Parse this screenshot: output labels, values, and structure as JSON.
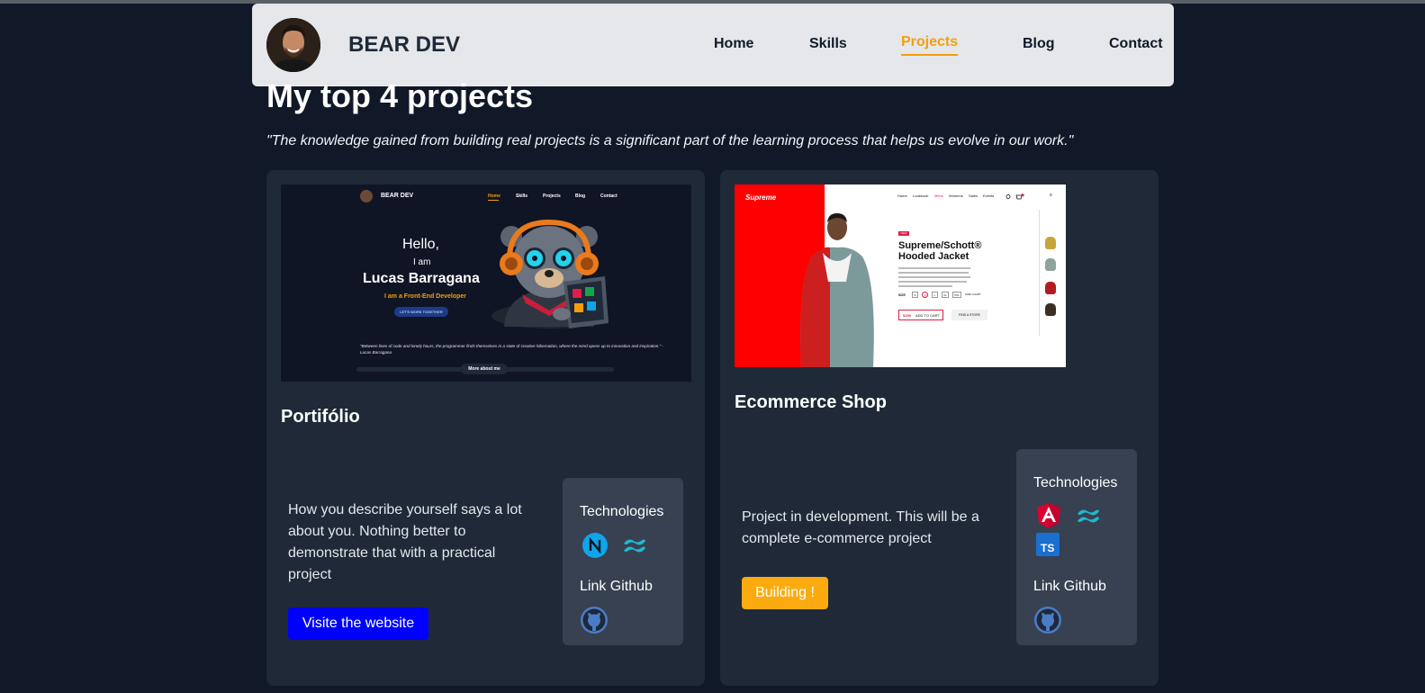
{
  "brand": {
    "name": "BEAR DEV"
  },
  "nav": {
    "items": [
      {
        "label": "Home"
      },
      {
        "label": "Skills"
      },
      {
        "label": "Projects"
      },
      {
        "label": "Blog"
      },
      {
        "label": "Contact"
      }
    ],
    "active": "Projects",
    "active_color": "#f59e0b"
  },
  "main": {
    "title": "My top 4 projects",
    "quote": "\"The knowledge gained from building real projects is a significant part of the learning process that helps us evolve in our work.\""
  },
  "projects": [
    {
      "title": "Portifólio",
      "description": "How you describe yourself says a lot about you. Nothing better to demonstrate that with a practical project",
      "button_label": "Visite the website",
      "button_color": "#0000ff",
      "technologies_label": "Technologies",
      "technologies": [
        "nextjs-icon",
        "tailwind-icon"
      ],
      "github_label": "Link Github",
      "screenshot": {
        "brand": "BEAR DEV",
        "nav": [
          "Home",
          "Skills",
          "Projects",
          "Blog",
          "Contact"
        ],
        "hello": "Hello,",
        "iam": "I am",
        "name": "Lucas Barragana",
        "role": "I am a Front-End Developer",
        "cta": "LET'S WORK TOGETHER",
        "quote": "\"Between lines of code and lonely hours, the programmer finds themselves in a state of creative hibernation, where the mind opens up to innovation and inspiration.\" - Lucas Barragana",
        "more": "More about me"
      }
    },
    {
      "title": "Ecommerce Shop",
      "description": "Project in development. This will be a complete e-commerce project",
      "button_label": "Building !",
      "button_color": "#fbab0f",
      "technologies_label": "Technologies",
      "technologies": [
        "angular-icon",
        "tailwind-icon",
        "typescript-icon"
      ],
      "github_label": "Link Github",
      "screenshot": {
        "logo": "Supreme",
        "nav": [
          "Home",
          "Lookbook",
          "Mens",
          "Womens",
          "Sales",
          "Events"
        ],
        "badge": "NEW",
        "product": "Supreme/Schott® Hooded Jacket",
        "price": "$199",
        "add": "ADD TO CART",
        "find": "FIND A STORE",
        "size_label": "SIZE",
        "sizes": [
          "S",
          "M",
          "L",
          "XL",
          "XXL"
        ],
        "size_chart": "SIZE CHART"
      }
    }
  ]
}
